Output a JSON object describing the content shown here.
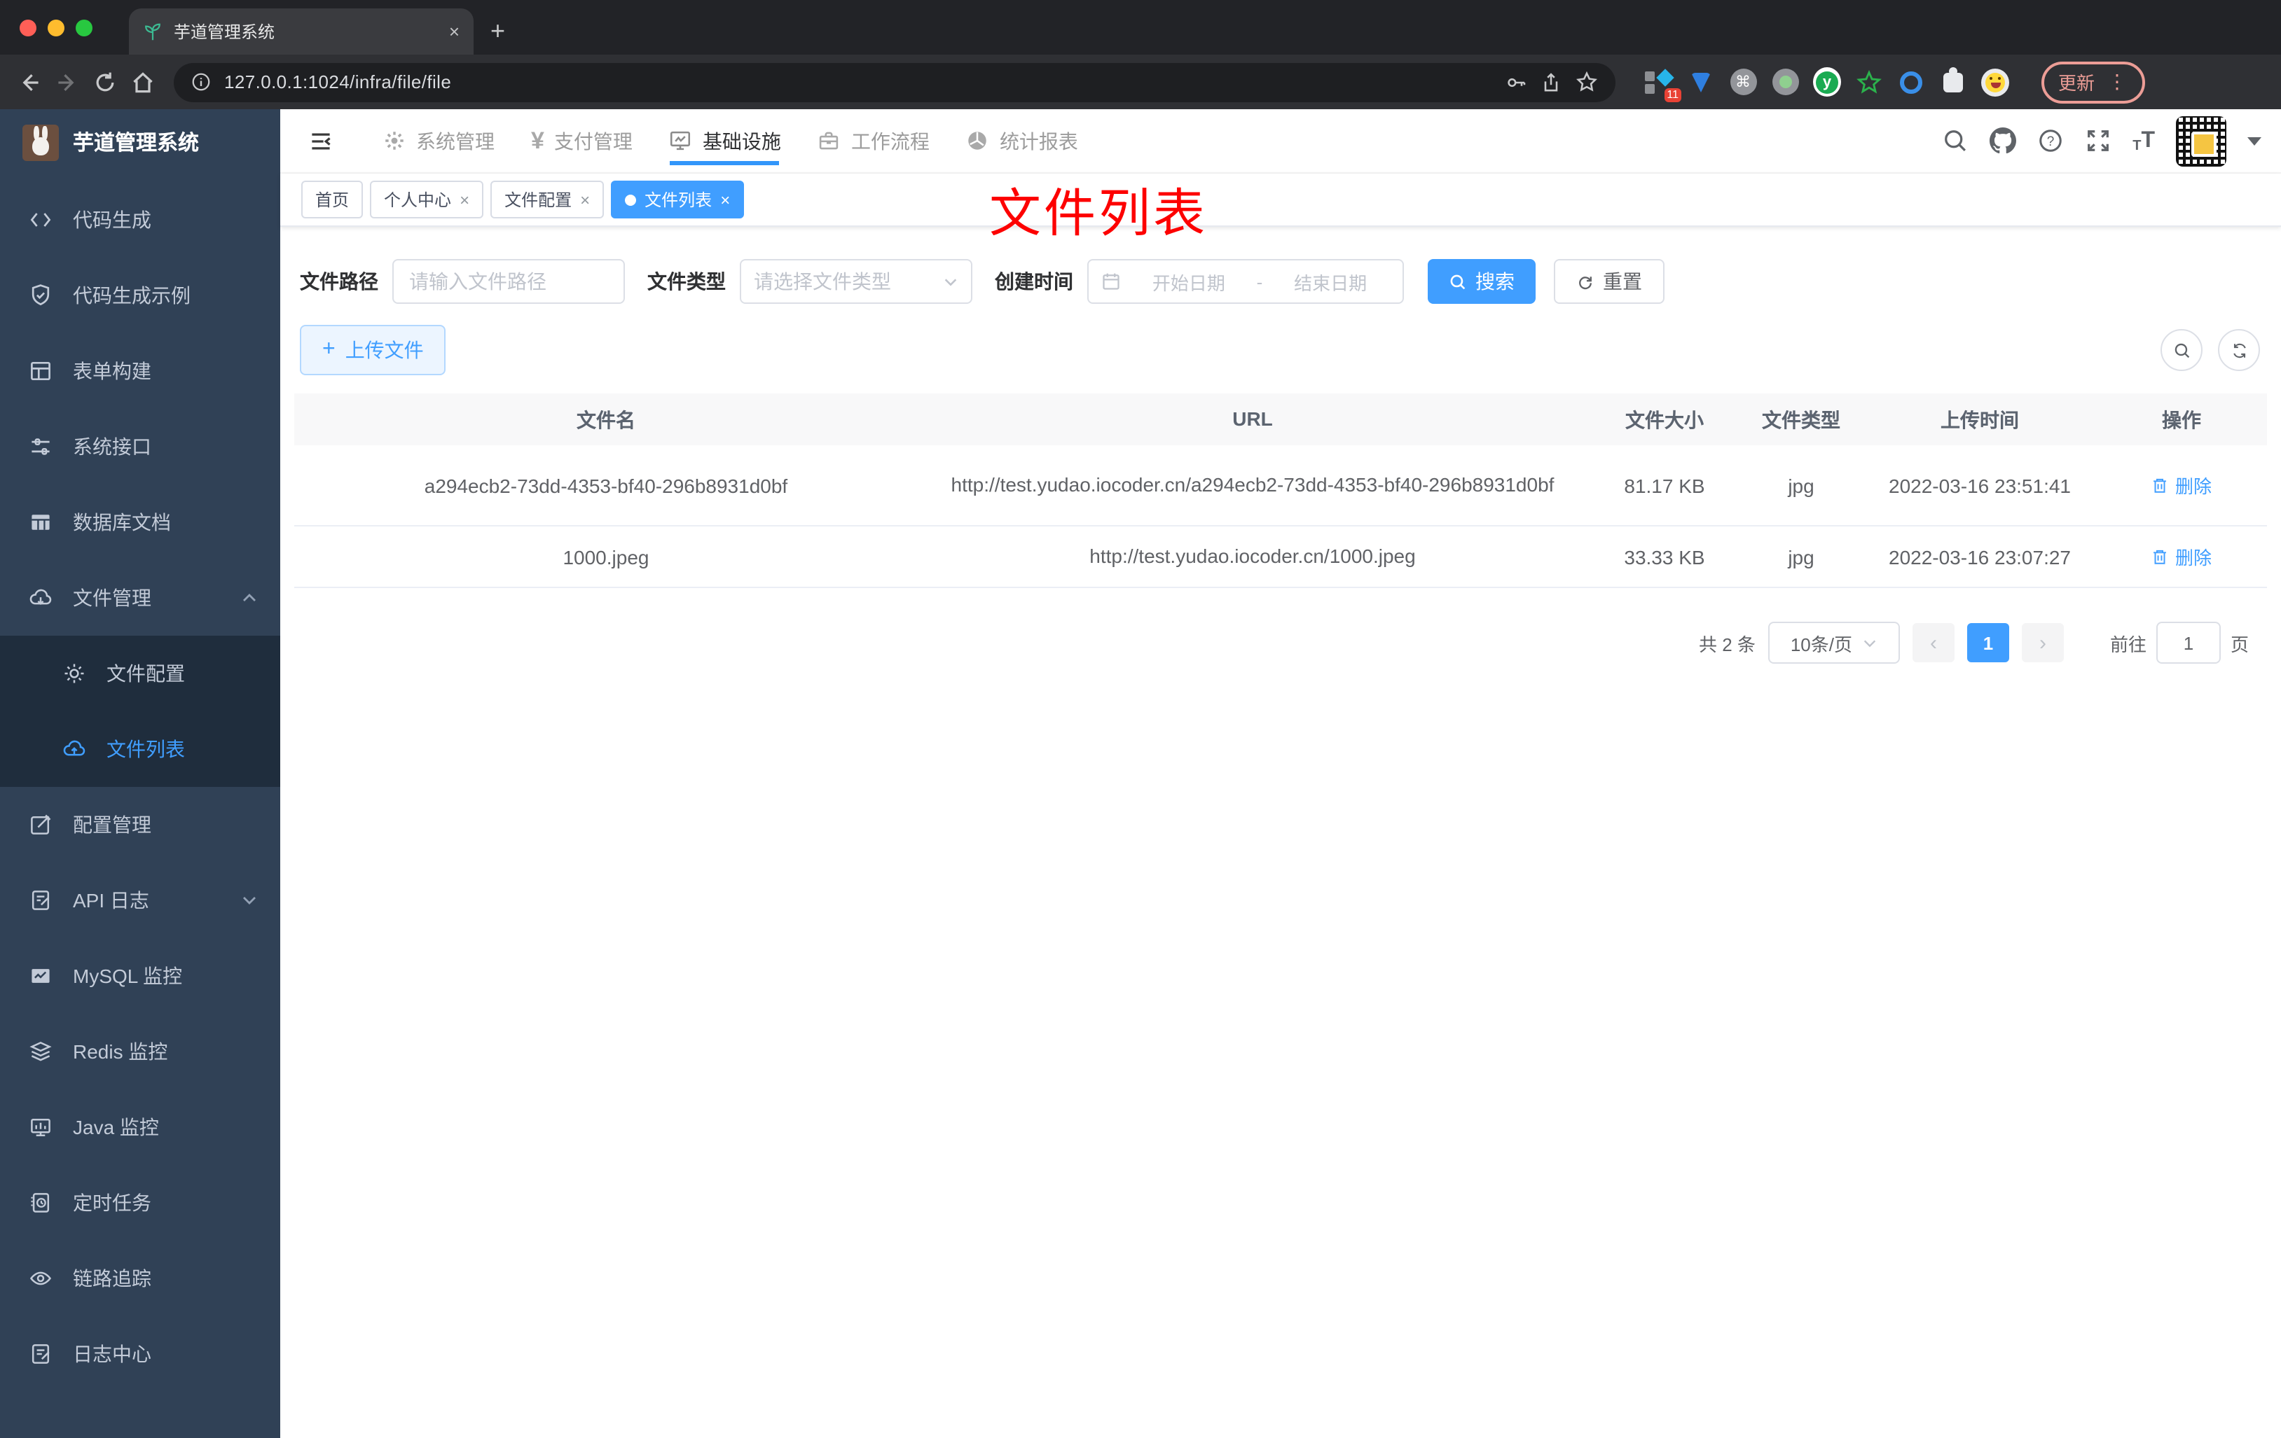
{
  "colors": {
    "accent": "#409eff",
    "annotation_red": "#fd0000",
    "sidebar_bg": "#304156",
    "submenu_bg": "#1f2d3d"
  },
  "browser": {
    "tab_title": "芋道管理系统",
    "url": "127.0.0.1:1024/infra/file/file",
    "extension_badge": "11",
    "update_label": "更新"
  },
  "icons": {
    "close": "×",
    "plus": "+",
    "prev": "‹",
    "next": "›",
    "yen": "¥",
    "more": "⋮",
    "command": "⌘",
    "y_letter": "y",
    "t_small": "T",
    "t_big": "T"
  },
  "sidebar": {
    "title": "芋道管理系统",
    "items": [
      {
        "label": "代码生成"
      },
      {
        "label": "代码生成示例"
      },
      {
        "label": "表单构建"
      },
      {
        "label": "系统接口"
      },
      {
        "label": "数据库文档"
      },
      {
        "label": "文件管理",
        "children": [
          {
            "label": "文件配置"
          },
          {
            "label": "文件列表"
          }
        ]
      },
      {
        "label": "配置管理"
      },
      {
        "label": "API 日志"
      },
      {
        "label": "MySQL 监控"
      },
      {
        "label": "Redis 监控"
      },
      {
        "label": "Java 监控"
      },
      {
        "label": "定时任务"
      },
      {
        "label": "链路追踪"
      },
      {
        "label": "日志中心"
      }
    ]
  },
  "topnav": {
    "items": [
      {
        "label": "系统管理"
      },
      {
        "label": "支付管理"
      },
      {
        "label": "基础设施"
      },
      {
        "label": "工作流程"
      },
      {
        "label": "统计报表"
      }
    ]
  },
  "tags": {
    "items": [
      {
        "label": "首页"
      },
      {
        "label": "个人中心"
      },
      {
        "label": "文件配置"
      },
      {
        "label": "文件列表"
      }
    ]
  },
  "annotation": {
    "text": "文件列表"
  },
  "filters": {
    "path_label": "文件路径",
    "path_placeholder": "请输入文件路径",
    "type_label": "文件类型",
    "type_placeholder": "请选择文件类型",
    "time_label": "创建时间",
    "start_placeholder": "开始日期",
    "separator": "-",
    "end_placeholder": "结束日期",
    "search_label": "搜索",
    "reset_label": "重置"
  },
  "toolbar": {
    "upload_label": "上传文件"
  },
  "table": {
    "headers": [
      "文件名",
      "URL",
      "文件大小",
      "文件类型",
      "上传时间",
      "操作"
    ],
    "rows": [
      {
        "name": "a294ecb2-73dd-4353-bf40-296b8931d0bf",
        "url": "http://test.yudao.iocoder.cn/a294ecb2-73dd-4353-bf40-296b8931d0bf",
        "size": "81.17 KB",
        "type": "jpg",
        "time": "2022-03-16 23:51:41",
        "action": "删除"
      },
      {
        "name": "1000.jpeg",
        "url": "http://test.yudao.iocoder.cn/1000.jpeg",
        "size": "33.33 KB",
        "type": "jpg",
        "time": "2022-03-16 23:07:27",
        "action": "删除"
      }
    ]
  },
  "pagination": {
    "total": "共 2 条",
    "page_size": "10条/页",
    "current_page": "1",
    "goto_label": "前往",
    "goto_value": "1",
    "page_label": "页"
  }
}
